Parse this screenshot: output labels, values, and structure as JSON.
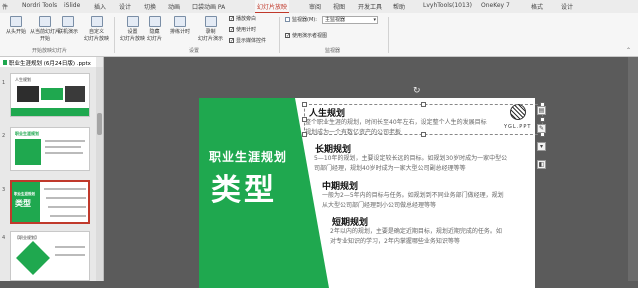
{
  "tabs": [
    "件",
    "Nordri Tools",
    "iSlide",
    "插入",
    "设计",
    "切换",
    "动画",
    "口袋动画 PA",
    "幻灯片放映",
    "审阅",
    "视图",
    "开发工具",
    "帮助",
    "LvyhTools(1013)",
    "OneKey 7",
    "格式",
    "设计"
  ],
  "active_tab_index": 8,
  "ribbon": {
    "group1": {
      "from_start": "从头开始",
      "from_current_line1": "从当前幻灯片",
      "from_current_line2": "开始",
      "online": "联机演示",
      "custom_line1": "自定义",
      "custom_line2": "幻灯片放映",
      "label": "开始放映幻灯片"
    },
    "group2": {
      "setup_line1": "设置",
      "setup_line2": "幻灯片放映",
      "hide_line1": "隐藏",
      "hide_line2": "幻灯片",
      "rehearse": "排练计时",
      "record_line1": "录制",
      "record_line2": "幻灯片演示",
      "play_narration": "播放旁白",
      "use_timings": "使用计时",
      "show_media": "显示媒体控件",
      "label": "设置"
    },
    "group3": {
      "monitor_label": "监视器(M):",
      "monitor_value": "主监视器",
      "presenter_view": "使用演示者视图",
      "label": "监视器"
    }
  },
  "panel": {
    "file_title": "职业生涯规划 (6月24日版) .pptx",
    "slide_numbers": [
      "1",
      "2",
      "3",
      "4"
    ],
    "thumb1_title": "人生规划",
    "thumb2_title": "职业生涯规划",
    "thumb3_line1": "职业生涯规划",
    "thumb3_line2": "类型",
    "thumb4_title": "【职业规划】"
  },
  "slide": {
    "title_line1": "职业生涯规划",
    "title_line2": "类型",
    "logo_text": "YGL.PPT",
    "sections": [
      {
        "title": "人生规划",
        "desc_line1": "整个职业生涯的规划，时间长至40年左右，设定整个人生的发展目标",
        "desc_line2": "规划成为一个有数亿资产的公司老板"
      },
      {
        "title": "长期规划",
        "desc_line1": "5—10年的规划，主要设定较长远的目标。如规划30岁时成为一家中型公",
        "desc_line2": "司部门经理，规划40岁时成为一家大型公司副总经理等等"
      },
      {
        "title": "中期规划",
        "desc_line1": "一般为2—5年内的目标与任务。如规划到不同业务部门做经理，规划",
        "desc_line2": "从大型公司部门经理到小公司做总经理等等"
      },
      {
        "title": "短期规划",
        "desc_line1": "2年以内的规划，主要是确定近期目标，规划近期完成的任务。如",
        "desc_line2": "对专业知识的学习，2年内掌握哪些业务知识等等"
      }
    ]
  },
  "colors": {
    "accent": "#1fa84f",
    "tab_active": "#c0392b"
  },
  "icons": {
    "rotate": "rotate-handle-icon",
    "layout": "layout-options-icon",
    "brush": "style-brush-icon"
  }
}
